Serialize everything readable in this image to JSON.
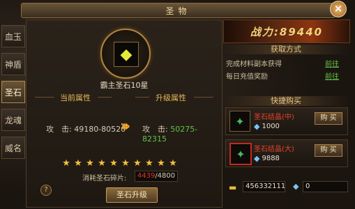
{
  "title": "圣物",
  "close_label": "×",
  "tabs": [
    "血玉",
    "神盾",
    "圣石",
    "龙魂",
    "威名"
  ],
  "active_tab": 2,
  "gem_name": "霸主圣石10星",
  "current_attr_label": "当前属性",
  "upgrade_attr_label": "升级属性",
  "attack_label": "攻　击:",
  "current_attack": "49180-80520",
  "upgrade_attack": "50275-82315",
  "star_count": 10,
  "cost_label": "消耗圣石碎片:",
  "cost_have": "4439",
  "cost_need": "/4800",
  "help_label": "?",
  "upgrade_button": "圣石升级",
  "power": "战力:89440",
  "obtain_header": "获取方式",
  "obtain_rows": [
    {
      "text": "完成材料副本获得",
      "go": "前往"
    },
    {
      "text": "每日充值奖励",
      "go": "前往"
    }
  ],
  "quick_buy_header": "快捷购买",
  "shop_items": [
    {
      "name": "圣石结晶(中)",
      "price": "1000",
      "buy": "购 买"
    },
    {
      "name": "圣石结晶(大)",
      "price": "9888",
      "buy": "购 买"
    }
  ],
  "gold_amount": "456332111",
  "diamond_amount": "0",
  "colors": {
    "accent": "#e5b858",
    "green": "#63c247",
    "red": "#e0342c"
  }
}
